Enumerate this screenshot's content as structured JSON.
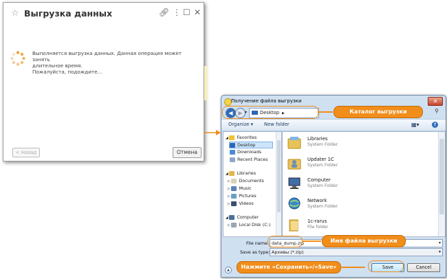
{
  "export_dialog": {
    "title": "Выгрузка данных",
    "message_line1": "Выполняется выгрузка данных. Данная операция может занять",
    "message_line2": "длительное время.",
    "message_line3": "Пожалуйста, подождите...",
    "back_label": "< Назад",
    "cancel_label": "Отмена",
    "icons": [
      "star-icon",
      "link-icon",
      "more-icon",
      "maximize-icon",
      "close-icon",
      "spinner-icon"
    ]
  },
  "save_dialog": {
    "window_title": "Получение файла выгрузки",
    "address": "Desktop",
    "toolbar": {
      "organize": "Organize ▾",
      "new_folder": "New folder"
    },
    "tree": {
      "favorites": "Favorites",
      "desktop": "Desktop",
      "downloads": "Downloads",
      "recent_places": "Recent Places",
      "libraries": "Libraries",
      "documents": "Documents",
      "music": "Music",
      "pictures": "Pictures",
      "videos": "Videos",
      "computer": "Computer",
      "local_disk": "Local Disk (C:)"
    },
    "files": [
      {
        "name": "Libraries",
        "type": "System Folder",
        "icon": "libraries-icon"
      },
      {
        "name": "Updater 1C",
        "type": "System Folder",
        "icon": "user-folder-icon"
      },
      {
        "name": "Computer",
        "type": "System Folder",
        "icon": "computer-icon"
      },
      {
        "name": "Network",
        "type": "System Folder",
        "icon": "network-icon"
      },
      {
        "name": "1c-rarus",
        "type": "File folder",
        "icon": "folder-icon"
      }
    ],
    "file_name_label": "File name:",
    "file_name_value": "data_dump.zip",
    "save_type_label": "Save as type:",
    "save_type_value": "Архивы (*.zip)",
    "save_label": "Save",
    "cancel_label": "Cancel"
  },
  "callouts": {
    "catalog": "Каталог выгрузки",
    "file_name": "Имя файла выгрузки",
    "press_save": "Нажмите «Сохранить»/«Save»"
  },
  "colors": {
    "accent": "#f18d1a",
    "window_frame": "#cfe0f1"
  }
}
